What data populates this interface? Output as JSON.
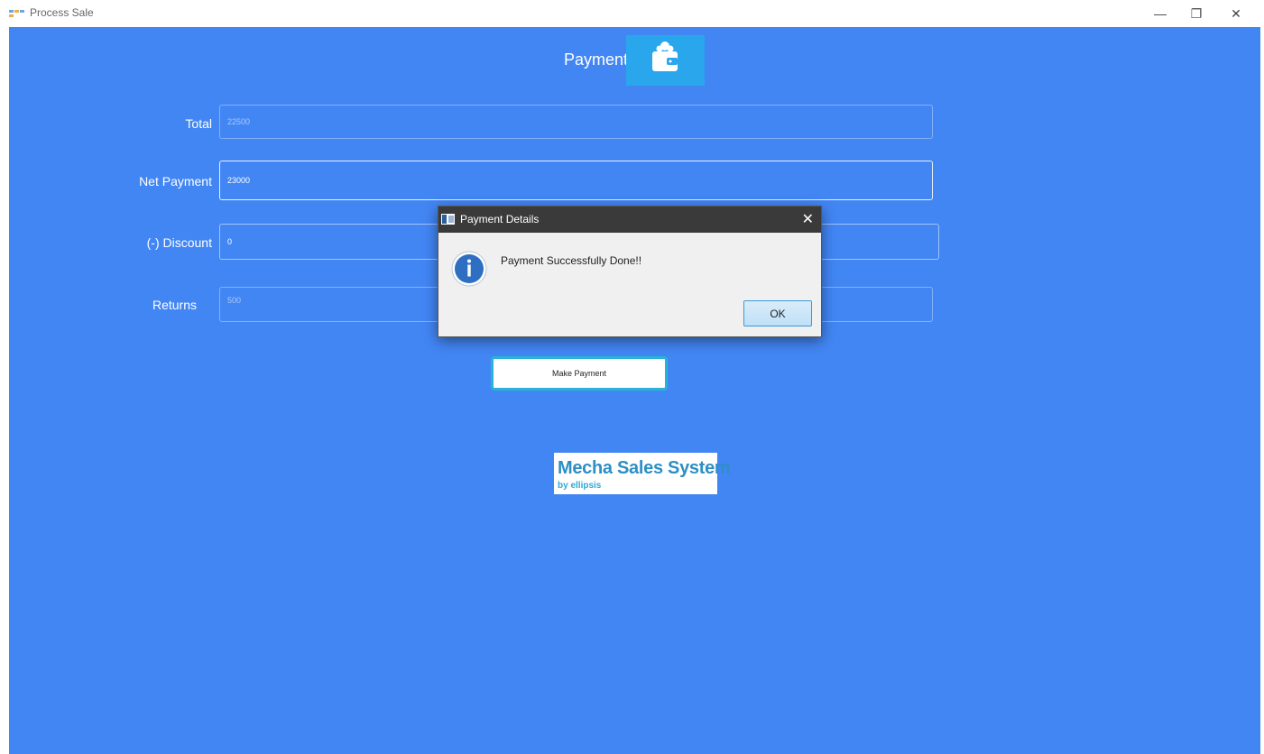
{
  "window": {
    "title": "Process Sale",
    "controls": {
      "minimize": "—",
      "maximize": "❐",
      "close": "✕"
    }
  },
  "header": {
    "title": "Payment",
    "icon": "wallet-icon"
  },
  "form": {
    "total": {
      "label": "Total",
      "value": "22500",
      "enabled": false
    },
    "net_payment": {
      "label": "Net Payment",
      "value": "23000",
      "enabled": true
    },
    "discount": {
      "label": "(-) Discount",
      "value": "0",
      "enabled": true
    },
    "returns": {
      "label": "Returns",
      "value": "500",
      "enabled": false
    }
  },
  "make_payment_label": "Make Payment",
  "logo": {
    "main": "Mecha Sales System",
    "sub": "by ellipsis"
  },
  "dialog": {
    "title": "Payment Details",
    "close": "✕",
    "icon": "info-icon",
    "message": "Payment Successfully Done!!",
    "ok_label": "OK"
  },
  "colors": {
    "background": "#4286f4",
    "header_icon_bg": "#2aa6ec",
    "button_border": "#2ab3d6",
    "dialog_titlebar": "#3a3a3a",
    "logo_text": "#2d8fc4"
  }
}
